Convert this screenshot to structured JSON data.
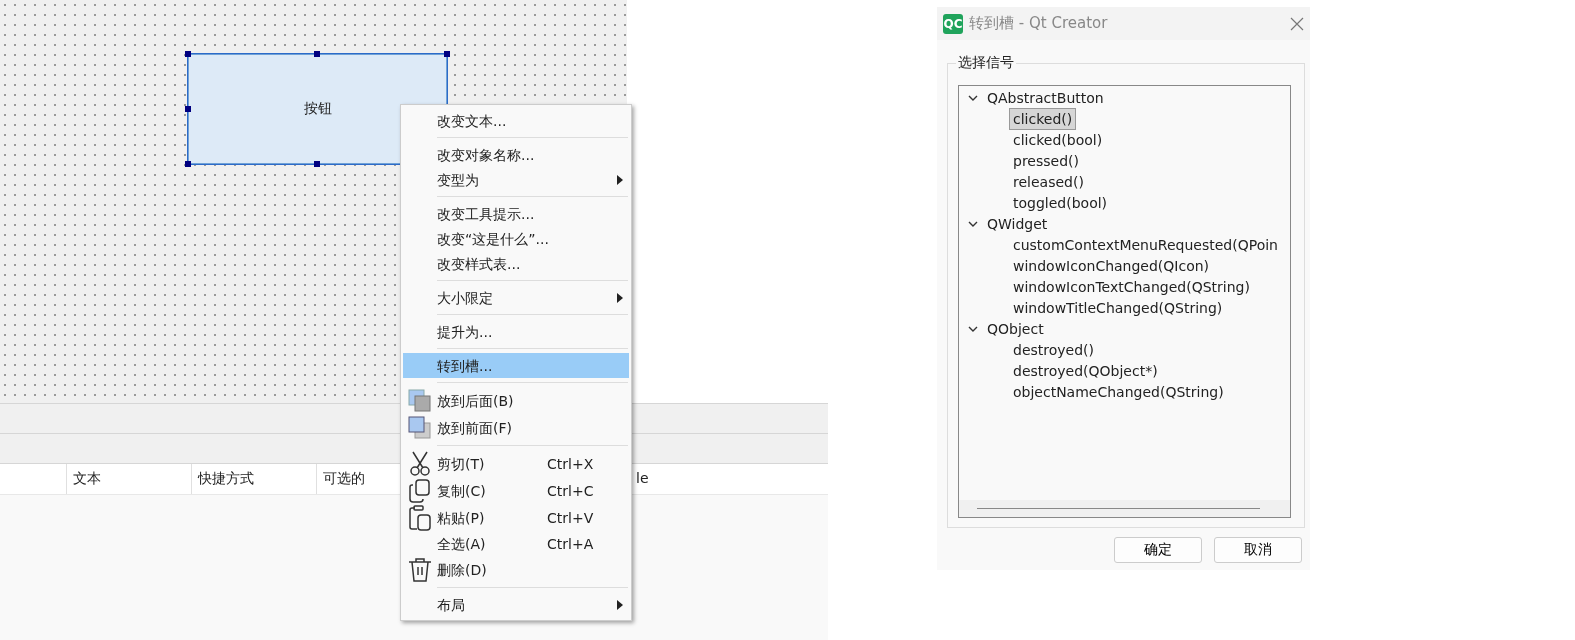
{
  "designer": {
    "button": {
      "label": "按钮",
      "selected": true
    },
    "action_table": {
      "columns": [
        {
          "label": "文本"
        },
        {
          "label": "快捷方式"
        },
        {
          "label": "可选的"
        },
        {
          "label": "le"
        }
      ]
    }
  },
  "context_menu": {
    "items": [
      {
        "kind": "item",
        "label": "改变文本...",
        "selected": false
      },
      {
        "kind": "separator"
      },
      {
        "kind": "item",
        "label": "改变对象名称...",
        "selected": false
      },
      {
        "kind": "item",
        "label": "变型为",
        "submenu": true,
        "selected": false
      },
      {
        "kind": "separator"
      },
      {
        "kind": "item",
        "label": "改变工具提示...",
        "selected": false
      },
      {
        "kind": "item",
        "label": "改变“这是什么”...",
        "selected": false
      },
      {
        "kind": "item",
        "label": "改变样式表...",
        "selected": false
      },
      {
        "kind": "separator"
      },
      {
        "kind": "item",
        "label": "大小限定",
        "submenu": true,
        "selected": false
      },
      {
        "kind": "separator"
      },
      {
        "kind": "item",
        "label": "提升为...",
        "selected": false
      },
      {
        "kind": "separator"
      },
      {
        "kind": "item",
        "label": "转到槽...",
        "selected": true
      },
      {
        "kind": "separator"
      },
      {
        "kind": "icon-item",
        "label": "放到后面(B)",
        "selected": false
      },
      {
        "kind": "icon-item",
        "label": "放到前面(F)",
        "selected": false
      },
      {
        "kind": "separator"
      },
      {
        "kind": "icon-item",
        "label": "剪切(T)",
        "shortcut": "Ctrl+X",
        "selected": false
      },
      {
        "kind": "icon-item",
        "label": "复制(C)",
        "shortcut": "Ctrl+C",
        "selected": false
      },
      {
        "kind": "icon-item",
        "label": "粘贴(P)",
        "shortcut": "Ctrl+V",
        "selected": false
      },
      {
        "kind": "item",
        "label": "全选(A)",
        "shortcut": "Ctrl+A",
        "selected": false
      },
      {
        "kind": "icon-item",
        "label": "删除(D)",
        "selected": false
      },
      {
        "kind": "separator"
      },
      {
        "kind": "item",
        "label": "布局",
        "submenu": true,
        "selected": false
      }
    ]
  },
  "dialog": {
    "title": "转到槽 - Qt Creator",
    "app_badge": "QC",
    "group_title": "选择信号",
    "tree": [
      {
        "label": "QAbstractButton",
        "expanded": true,
        "children": [
          {
            "label": "clicked()",
            "selected": true
          },
          {
            "label": "clicked(bool)",
            "selected": false
          },
          {
            "label": "pressed()",
            "selected": false
          },
          {
            "label": "released()",
            "selected": false
          },
          {
            "label": "toggled(bool)",
            "selected": false
          }
        ]
      },
      {
        "label": "QWidget",
        "expanded": true,
        "children": [
          {
            "label": "customContextMenuRequested(QPoin",
            "selected": false
          },
          {
            "label": "windowIconChanged(QIcon)",
            "selected": false
          },
          {
            "label": "windowIconTextChanged(QString)",
            "selected": false
          },
          {
            "label": "windowTitleChanged(QString)",
            "selected": false
          }
        ]
      },
      {
        "label": "QObject",
        "expanded": true,
        "children": [
          {
            "label": "destroyed()",
            "selected": false
          },
          {
            "label": "destroyed(QObject*)",
            "selected": false
          },
          {
            "label": "objectNameChanged(QString)",
            "selected": false
          }
        ]
      }
    ],
    "buttons": [
      "确定",
      "取消"
    ]
  }
}
